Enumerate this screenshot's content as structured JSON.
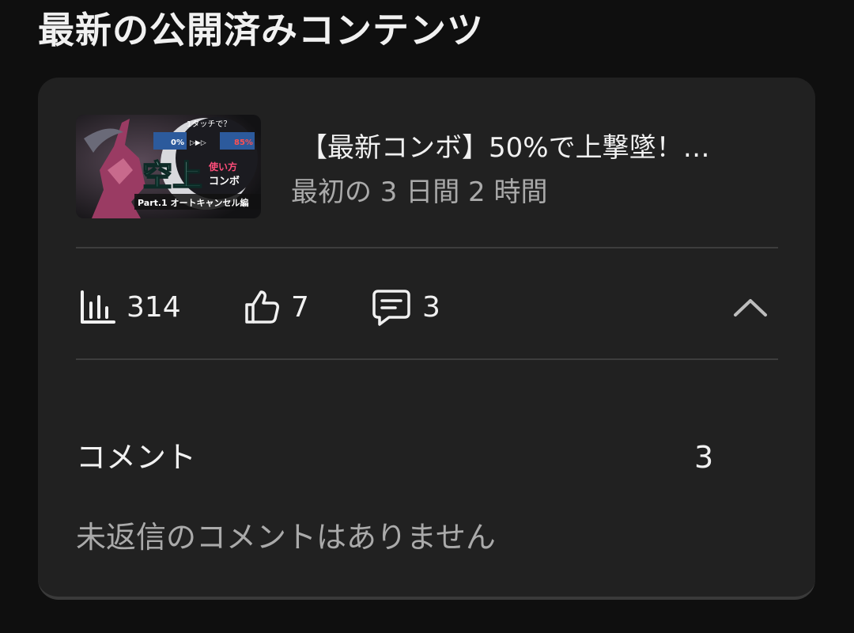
{
  "section": {
    "title": "最新の公開済みコンテンツ"
  },
  "video": {
    "title": "【最新コンボ】50%で上撃墜！…",
    "meta": "最初の 3 日間 2 時間",
    "thumbnail": {
      "top_text": "1タッチで？",
      "pct_start": "0%",
      "pct_end": "85%",
      "main_text": "空上",
      "side_text_1": "使い方",
      "side_text_2": "コンボ",
      "bottom_text": "Part.1 オートキャンセル編"
    }
  },
  "stats": {
    "views_icon": "bar-chart-icon",
    "views": "314",
    "likes_icon": "thumbs-up-icon",
    "likes": "7",
    "comments_icon": "comment-icon",
    "comments": "3",
    "collapse_icon": "chevron-up-icon"
  },
  "comments": {
    "label": "コメント",
    "count": "3",
    "no_reply_text": "未返信のコメントはありません"
  },
  "colors": {
    "background": "#0f0f0f",
    "card": "#212121",
    "divider": "#3d3d3d",
    "text_primary": "#f1f1f1",
    "text_secondary": "#aaaaaa"
  }
}
